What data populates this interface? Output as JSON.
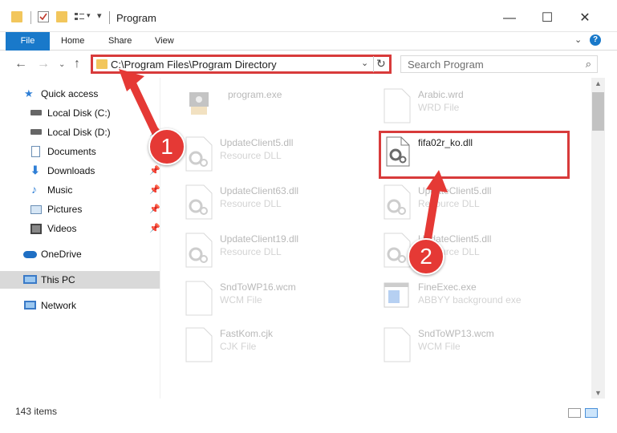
{
  "window": {
    "title": "Program",
    "minimize": "—",
    "maximize": "☐",
    "close": "✕"
  },
  "ribbon": {
    "tabs": [
      "File",
      "Home",
      "Share",
      "View"
    ],
    "help": "?"
  },
  "address": {
    "path": "C:\\Program Files\\Program Directory",
    "dropdown": "⌄",
    "refresh": "↻"
  },
  "search": {
    "placeholder": "Search Program",
    "icon": "search-icon"
  },
  "sidebar": {
    "items": [
      {
        "label": "Quick access",
        "icon": "star-icon"
      },
      {
        "label": "Local Disk (C:)",
        "icon": "drive-icon"
      },
      {
        "label": "Local Disk (D:)",
        "icon": "drive-icon"
      },
      {
        "label": "Documents",
        "icon": "documents-icon"
      },
      {
        "label": "Downloads",
        "icon": "download-icon"
      },
      {
        "label": "Music",
        "icon": "music-icon"
      },
      {
        "label": "Pictures",
        "icon": "pictures-icon"
      },
      {
        "label": "Videos",
        "icon": "videos-icon"
      },
      {
        "label": "OneDrive",
        "icon": "cloud-icon"
      },
      {
        "label": "This PC",
        "icon": "computer-icon"
      },
      {
        "label": "Network",
        "icon": "network-icon"
      }
    ]
  },
  "files": {
    "left": [
      {
        "name": "program.exe",
        "type": ""
      },
      {
        "name": "UpdateClient5.dll",
        "type": "Resource DLL"
      },
      {
        "name": "UpdateClient63.dll",
        "type": "Resource DLL"
      },
      {
        "name": "UpdateClient19.dll",
        "type": "Resource DLL"
      },
      {
        "name": "SndToWP16.wcm",
        "type": "WCM File"
      },
      {
        "name": "FastKom.cjk",
        "type": "CJK File"
      }
    ],
    "right": [
      {
        "name": "Arabic.wrd",
        "type": "WRD File"
      },
      {
        "name": "fifa02r_ko.dll",
        "type": ""
      },
      {
        "name": "UpdateClient5.dll",
        "type": "Resource DLL"
      },
      {
        "name": "UpdateClient5.dll",
        "type": "Resource DLL"
      },
      {
        "name": "FineExec.exe",
        "type": "ABBYY background exe"
      },
      {
        "name": "SndToWP13.wcm",
        "type": "WCM File"
      }
    ]
  },
  "status": {
    "count": "143 items"
  },
  "annotations": {
    "step1": "1",
    "step2": "2",
    "accent": "#e53935"
  }
}
